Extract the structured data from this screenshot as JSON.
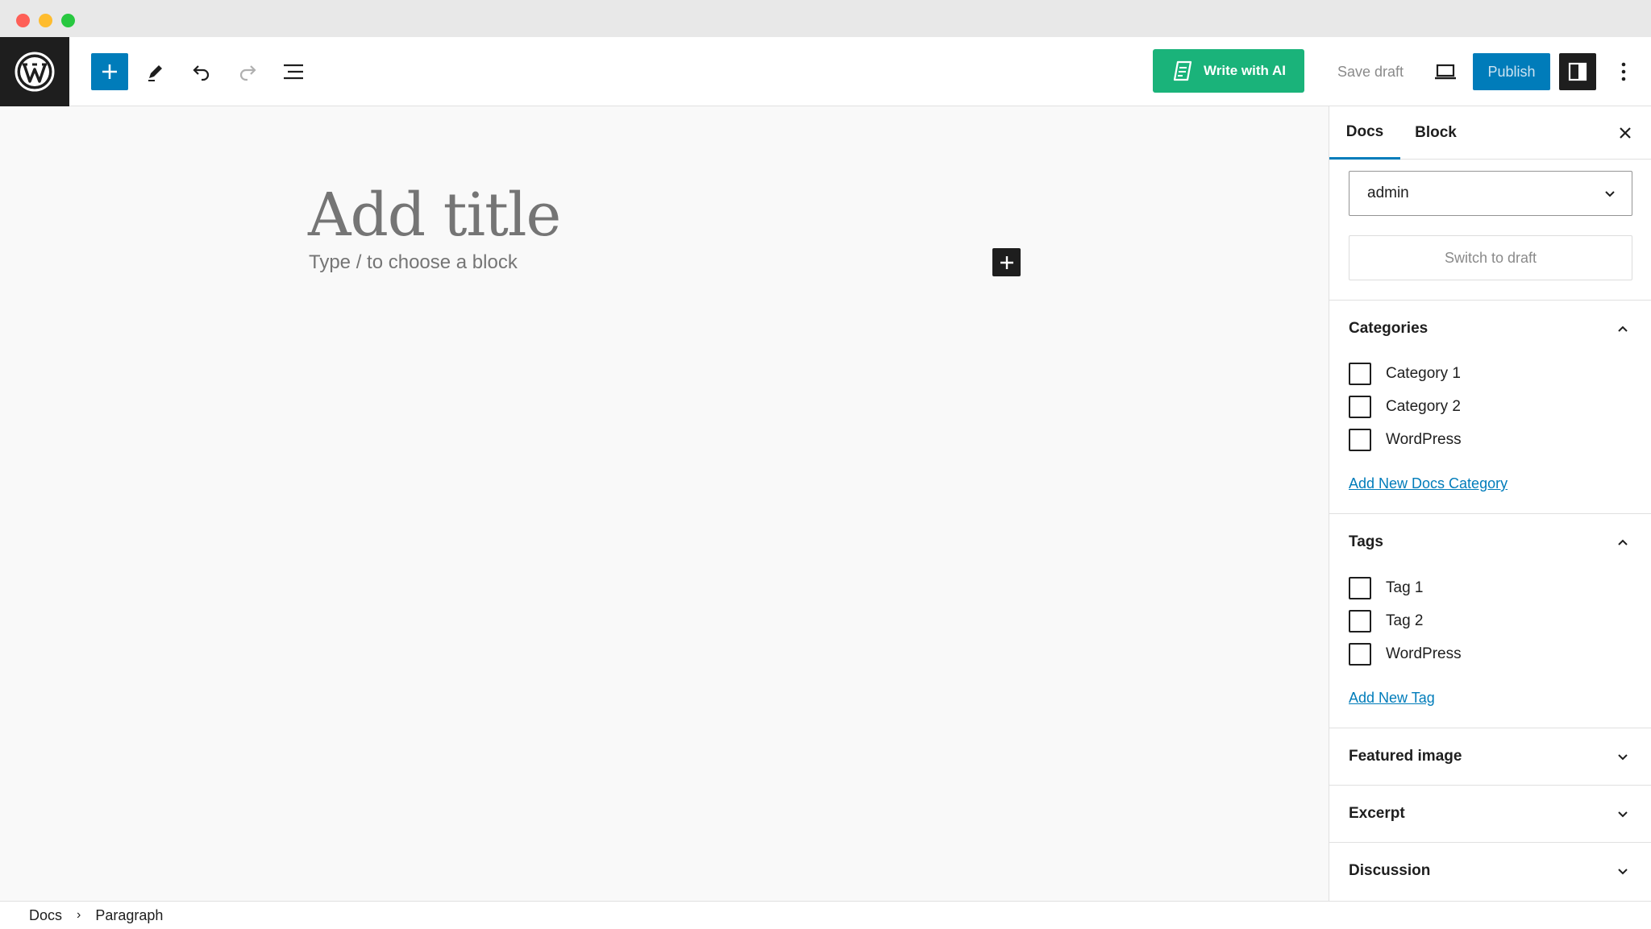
{
  "toolbar": {
    "write_ai_label": "Write with AI",
    "save_draft_label": "Save draft",
    "publish_label": "Publish"
  },
  "editor": {
    "title_placeholder": "Add title",
    "block_placeholder": "Type / to choose a block"
  },
  "sidebar": {
    "tabs": [
      {
        "label": "Docs",
        "active": true
      },
      {
        "label": "Block",
        "active": false
      }
    ],
    "author": "admin",
    "switch_to_draft": "Switch to draft",
    "categories": {
      "title": "Categories",
      "items": [
        "Category 1",
        "Category 2",
        "WordPress"
      ],
      "add_link": "Add New Docs Category"
    },
    "tags": {
      "title": "Tags",
      "items": [
        "Tag 1",
        "Tag 2",
        "WordPress"
      ],
      "add_link": "Add New Tag"
    },
    "collapsed_panels": [
      "Featured image",
      "Excerpt",
      "Discussion"
    ]
  },
  "breadcrumbs": [
    "Docs",
    "Paragraph"
  ],
  "colors": {
    "accent": "#007cba",
    "ai_green": "#1ab37a",
    "dark": "#1e1e1e"
  }
}
